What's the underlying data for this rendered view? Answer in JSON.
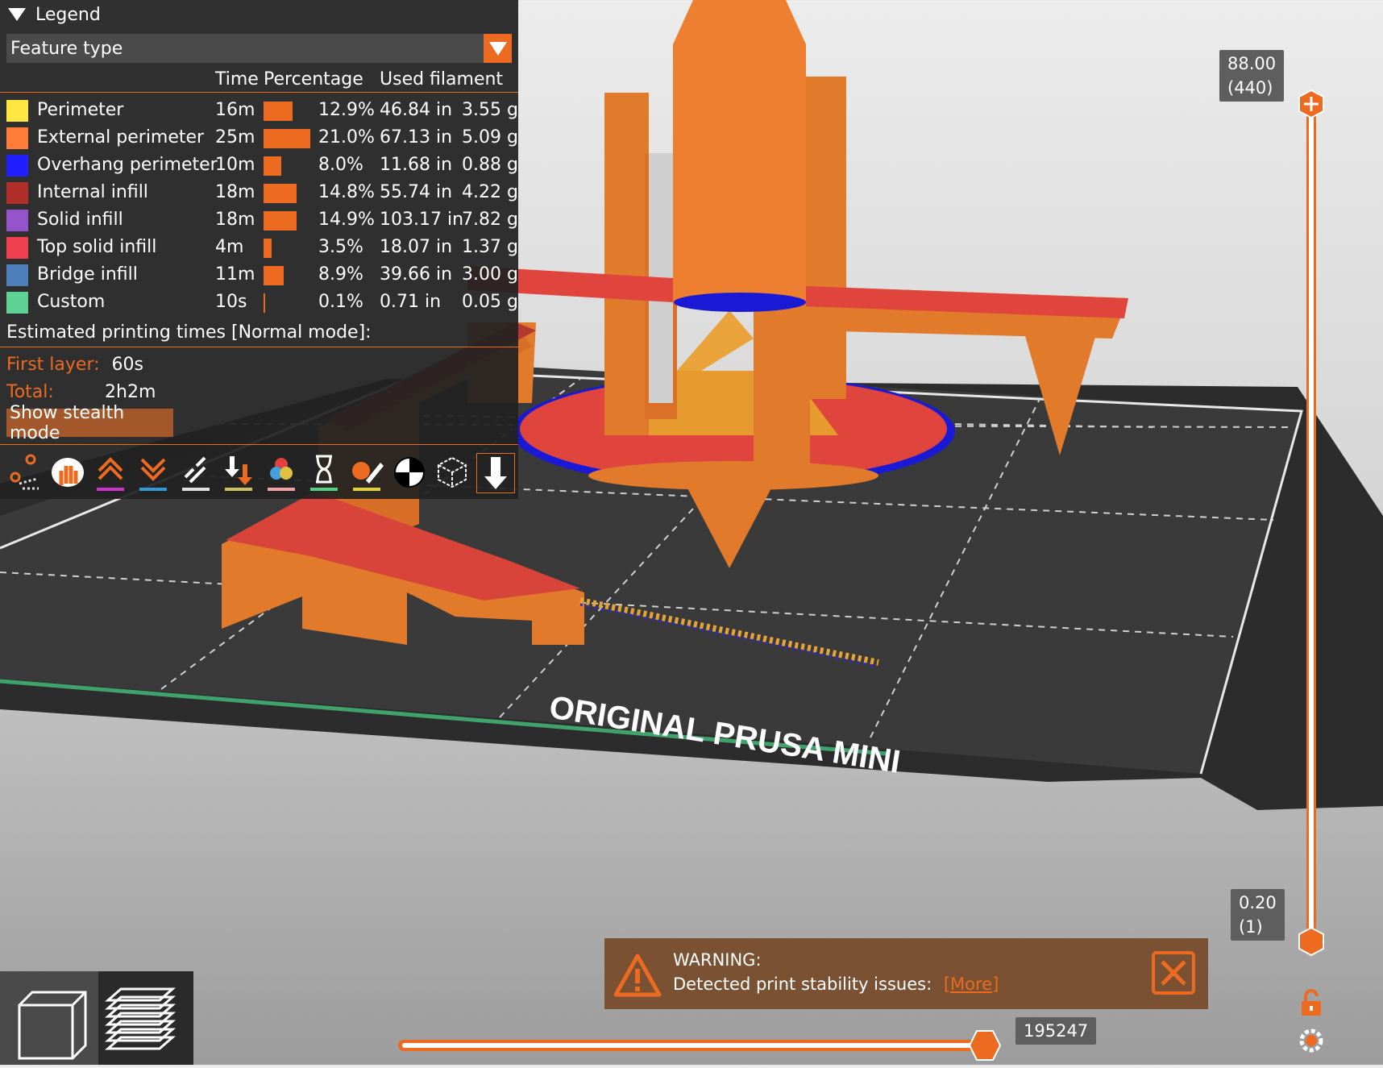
{
  "legend": {
    "title": "Legend",
    "view_type": "Feature type",
    "columns": {
      "time": "Time",
      "percentage": "Percentage",
      "used_filament": "Used filament"
    },
    "rows": [
      {
        "name": "Perimeter",
        "color": "#FFE640",
        "time": "16m",
        "pct": "12.9%",
        "length": "46.84 in",
        "weight": "3.55 g",
        "pct_value": 12.9
      },
      {
        "name": "External perimeter",
        "color": "#FF7D38",
        "time": "25m",
        "pct": "21.0%",
        "length": "67.13 in",
        "weight": "5.09 g",
        "pct_value": 21.0
      },
      {
        "name": "Overhang perimeter",
        "color": "#1F1FFF",
        "time": "10m",
        "pct": "8.0%",
        "length": "11.68 in",
        "weight": "0.88 g",
        "pct_value": 8.0
      },
      {
        "name": "Internal infill",
        "color": "#B03029",
        "time": "18m",
        "pct": "14.8%",
        "length": "55.74 in",
        "weight": "4.22 g",
        "pct_value": 14.8
      },
      {
        "name": "Solid infill",
        "color": "#9654CC",
        "time": "18m",
        "pct": "14.9%",
        "length": "103.17 in",
        "weight": "7.82 g",
        "pct_value": 14.9
      },
      {
        "name": "Top solid infill",
        "color": "#F0404F",
        "time": "4m",
        "pct": "3.5%",
        "length": "18.07 in",
        "weight": "1.37 g",
        "pct_value": 3.5
      },
      {
        "name": "Bridge infill",
        "color": "#4D80BA",
        "time": "11m",
        "pct": "8.9%",
        "length": "39.66 in",
        "weight": "3.00 g",
        "pct_value": 8.9
      },
      {
        "name": "Custom",
        "color": "#5ED194",
        "time": "10s",
        "pct": "0.1%",
        "length": "0.71 in",
        "weight": "0.05 g",
        "pct_value": 0.1
      }
    ],
    "estimate_title": "Estimated printing times [Normal mode]:",
    "first_layer_label": "First layer:",
    "first_layer_value": "60s",
    "total_label": "Total:",
    "total_value": "2h2m",
    "stealth_button": "Show stealth mode"
  },
  "vertical_slider": {
    "top_value": "88.00",
    "top_layer": "(440)",
    "bottom_value": "0.20",
    "bottom_layer": "(1)"
  },
  "horizontal_slider": {
    "value": "195247"
  },
  "warning": {
    "title": "WARNING:",
    "message": "Detected print stability issues:",
    "link": "[More]"
  },
  "bed_label": "ORIGINAL PRUSA MINI",
  "colors": {
    "accent": "#ED6B21",
    "panel": "#212121"
  }
}
